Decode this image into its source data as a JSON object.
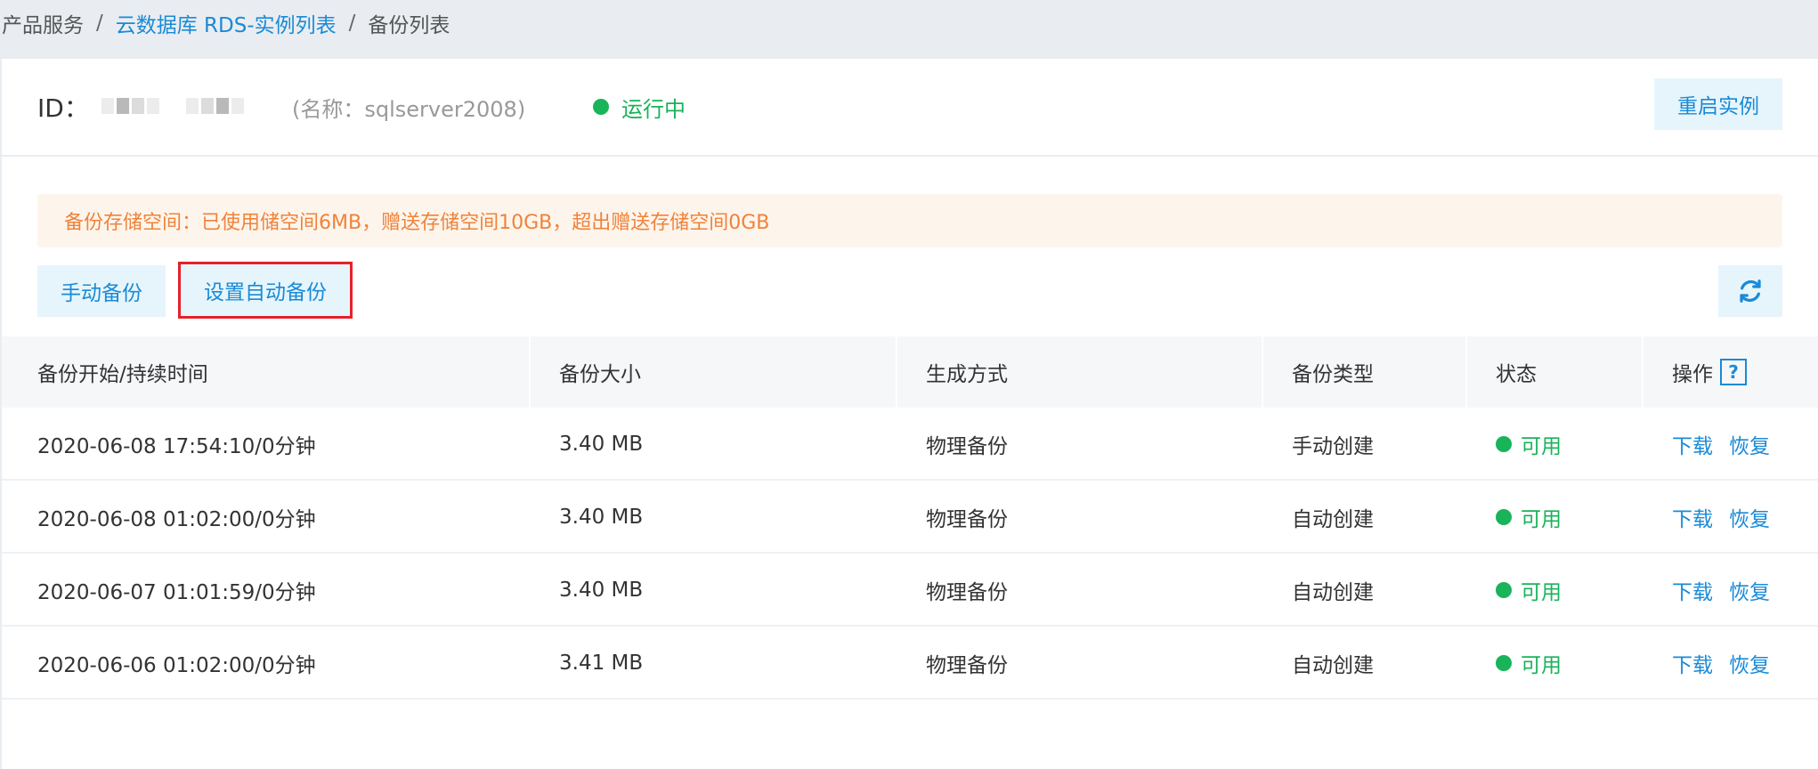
{
  "breadcrumb": {
    "items": [
      "产品服务",
      "云数据库 RDS-实例列表",
      "备份列表"
    ],
    "separator": "/"
  },
  "instance": {
    "id_label": "ID：",
    "name": "(名称：sqlserver2008)",
    "status": "运行中",
    "restart_label": "重启实例"
  },
  "notice": "备份存储空间：已使用储空间6MB，赠送存储空间10GB，超出赠送存储空间0GB",
  "toolbar": {
    "manual_backup": "手动备份",
    "auto_backup": "设置自动备份"
  },
  "table": {
    "headers": [
      "备份开始/持续时间",
      "备份大小",
      "生成方式",
      "备份类型",
      "状态",
      "操作"
    ],
    "rows": [
      {
        "time": "2020-06-08 17:54:10/0分钟",
        "size": "3.40 MB",
        "method": "物理备份",
        "type": "手动创建",
        "status": "可用"
      },
      {
        "time": "2020-06-08 01:02:00/0分钟",
        "size": "3.40 MB",
        "method": "物理备份",
        "type": "自动创建",
        "status": "可用"
      },
      {
        "time": "2020-06-07 01:01:59/0分钟",
        "size": "3.40 MB",
        "method": "物理备份",
        "type": "自动创建",
        "status": "可用"
      },
      {
        "time": "2020-06-06 01:02:00/0分钟",
        "size": "3.41 MB",
        "method": "物理备份",
        "type": "自动创建",
        "status": "可用"
      }
    ],
    "actions": {
      "download": "下载",
      "restore": "恢复"
    },
    "help_icon": "?"
  },
  "colors": {
    "accent": "#1a8ad6",
    "success": "#19b35a",
    "warning": "#f0823a",
    "highlight": "#e6202a"
  },
  "icons": {
    "refresh": "refresh-icon",
    "help": "help-icon",
    "status": "status-dot-icon"
  }
}
